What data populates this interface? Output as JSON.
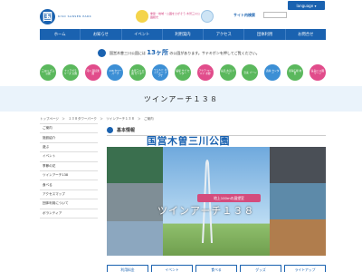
{
  "header": {
    "logo_letter": "国",
    "logo_sub": "KISO SANSEN PARK",
    "logo_main": "国営木曽三川公園",
    "tagline": "季節・地域・公園をさがそう 木曽三川公園観光",
    "search_label": "サイト内検索",
    "language_label": "language ▾"
  },
  "nav": {
    "items": [
      "ホーム",
      "お知らせ",
      "イベント",
      "利用案内",
      "アクセス",
      "団体利用",
      "お問合せ"
    ]
  },
  "notice": {
    "prefix": "国営木曽三川公園には",
    "highlight": "13ヶ所",
    "suffix": "の公園があります。サテキポンを押してご覧ください。"
  },
  "parks": [
    {
      "label": "三派川 ぎふ 公園",
      "color": "#5bb85d"
    },
    {
      "label": "ナイアガラ ミーズ 公園",
      "color": "#5bb85d"
    },
    {
      "label": "河川 環境楽園",
      "color": "#e14c8b"
    },
    {
      "label": "138 タワー パーク",
      "color": "#3c8fd5"
    },
    {
      "label": "木曽三川 公園 センター",
      "color": "#5bb85d"
    },
    {
      "label": "ワイルド ネイチャー プラザ",
      "color": "#3c8fd5"
    },
    {
      "label": "桜堤 サブ センター",
      "color": "#5bb85d"
    },
    {
      "label": "アクア ワールド 水郷",
      "color": "#e14c8b"
    },
    {
      "label": "長島 水辺 ゾーン",
      "color": "#5bb85d"
    },
    {
      "label": "宝来 ゾーン",
      "color": "#5bb85d"
    },
    {
      "label": "森林 センター",
      "color": "#3c8fd5"
    },
    {
      "label": "東海広場 地区",
      "color": "#5bb85d"
    },
    {
      "label": "長良川 公園 ゾーン",
      "color": "#e14c8b"
    }
  ],
  "page": {
    "title": "ツインアーチ１３８",
    "breadcrumb": "トップページ　＞　１３８タワーパーク　＞　ツインアーチ１３８　＞　ご案内"
  },
  "sidebar": {
    "items": [
      "ご案内",
      "施設紹介",
      "遊ぶ",
      "イベント",
      "季節の花",
      "ツインアーチ138",
      "食べる",
      "アクセスマップ",
      "団体利用について",
      "ボランティア"
    ]
  },
  "main": {
    "section_title": "基本情報",
    "banner": "地上100mの展望室",
    "photo_title": "ツインアーチ１３８",
    "buttons": [
      "利用料金",
      "イベント",
      "食べる",
      "グッズ",
      "ライトアップ"
    ]
  }
}
